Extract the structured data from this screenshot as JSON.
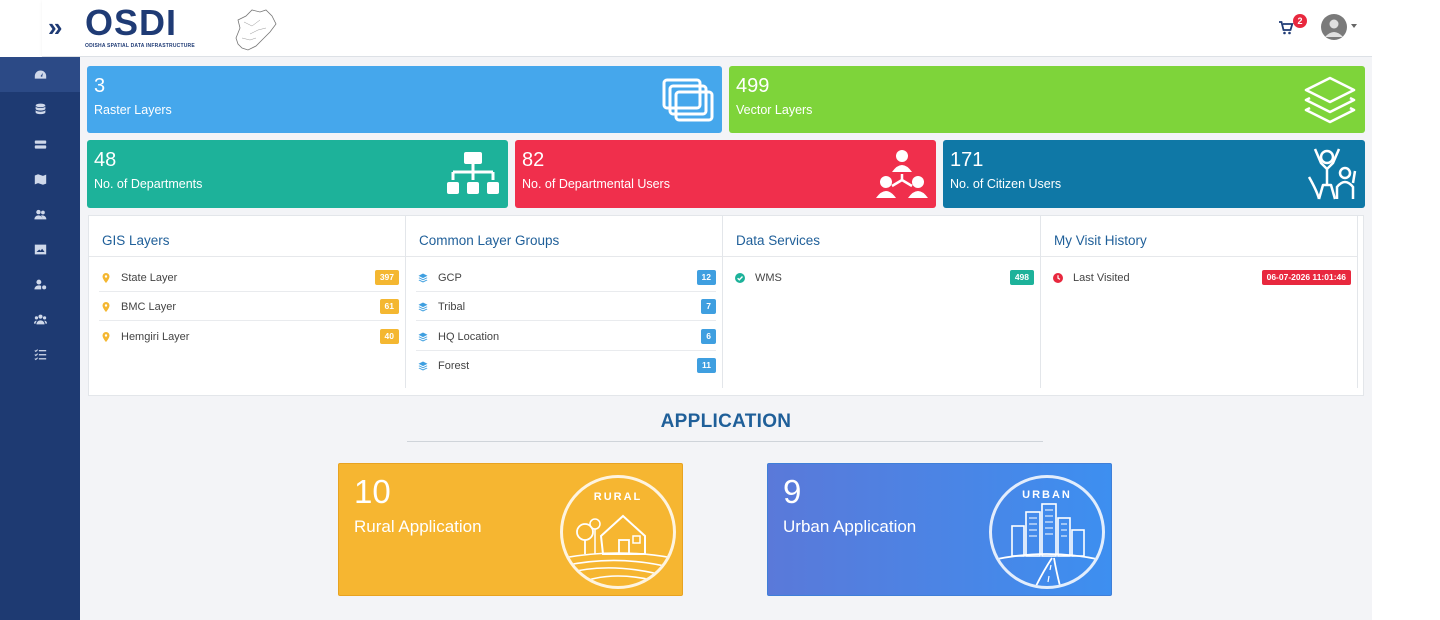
{
  "brand": {
    "name": "OSDI",
    "subtitle": "ODISHA SPATIAL DATA INFRASTRUCTURE"
  },
  "header": {
    "cart_count": "2"
  },
  "sidebar": {
    "items": [
      "dashboard-icon",
      "database-icon",
      "server-icon",
      "map-icon",
      "users-icon",
      "image-icon",
      "user-settings-icon",
      "group-icon",
      "checklist-icon"
    ]
  },
  "stats": [
    {
      "value": "3",
      "label": "Raster Layers",
      "color": "#45a7ec"
    },
    {
      "value": "499",
      "label": "Vector Layers",
      "color": "#7ed43a"
    },
    {
      "value": "48",
      "label": "No. of Departments",
      "color": "#1db29a"
    },
    {
      "value": "82",
      "label": "No. of Departmental Users",
      "color": "#f02f4c"
    },
    {
      "value": "171",
      "label": "No. of Citizen Users",
      "color": "#0f78a6"
    }
  ],
  "panels": {
    "gis": {
      "title": "GIS Layers",
      "rows": [
        {
          "label": "State Layer",
          "badge": "397"
        },
        {
          "label": "BMC Layer",
          "badge": "61"
        },
        {
          "label": "Hemgiri Layer",
          "badge": "40"
        }
      ]
    },
    "common": {
      "title": "Common Layer Groups",
      "rows": [
        {
          "label": "GCP",
          "badge": "12"
        },
        {
          "label": "Tribal",
          "badge": "7"
        },
        {
          "label": "HQ Location",
          "badge": "6"
        },
        {
          "label": "Forest",
          "badge": "11"
        }
      ]
    },
    "services": {
      "title": "Data Services",
      "rows": [
        {
          "label": "WMS",
          "badge": "498"
        }
      ]
    },
    "history": {
      "title": "My Visit History",
      "rows": [
        {
          "label": "Last Visited",
          "badge": "06-07-2026 11:01:46"
        }
      ]
    }
  },
  "application": {
    "title": "APPLICATION",
    "cards": [
      {
        "value": "10",
        "label": "Rural Application",
        "badge_text": "RURAL"
      },
      {
        "value": "9",
        "label": "Urban Application",
        "badge_text": "URBAN"
      }
    ]
  },
  "colors": {
    "sidebar": "#1e3a72",
    "title": "#1f5f99",
    "badge_orange": "#f4b731",
    "badge_blue": "#3f9fe0",
    "badge_green": "#1db29a",
    "badge_red": "#e8283e"
  }
}
